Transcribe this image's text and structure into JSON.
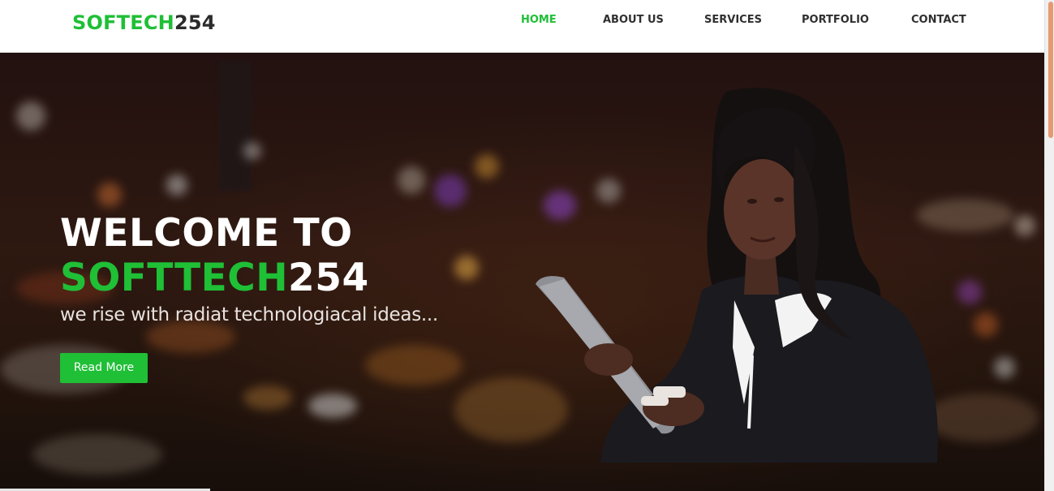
{
  "header": {
    "logo_primary": "SOFTECH",
    "logo_secondary": "254"
  },
  "nav": {
    "items": [
      {
        "label": "HOME",
        "active": true
      },
      {
        "label": "ABOUT US",
        "active": false
      },
      {
        "label": "SERVICES",
        "active": false
      },
      {
        "label": "PORTFOLIO",
        "active": false
      },
      {
        "label": "CONTACT",
        "active": false
      }
    ]
  },
  "hero": {
    "title_line1": "WELCOME TO",
    "title_brand_primary": "SOFTTECH",
    "title_brand_secondary": "254",
    "subtitle": "we rise with radiat technologiacal ideas...",
    "button_label": "Read More"
  },
  "colors": {
    "brand_green": "#1fbf36",
    "text_dark": "#2b2b2b",
    "scroll_thumb": "#e59a72"
  },
  "icons": {
    "person_image": "woman-with-tablet-image"
  }
}
